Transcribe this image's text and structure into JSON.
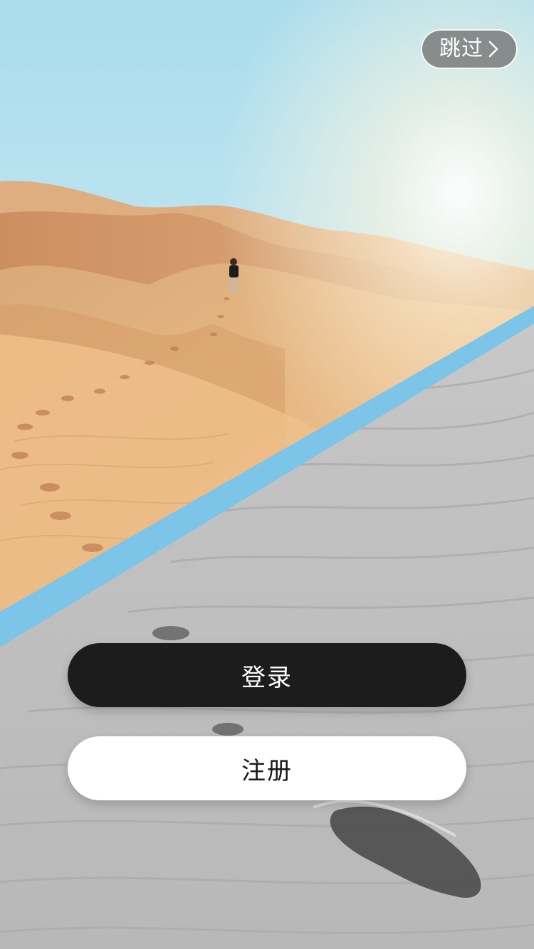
{
  "skip": {
    "label": "跳过",
    "icon": "chevron-right-icon"
  },
  "auth": {
    "login_label": "登录",
    "register_label": "注册"
  },
  "colors": {
    "accent_stripe": "#7cc4e8",
    "login_bg": "#1c1c1c",
    "register_bg": "#ffffff"
  }
}
